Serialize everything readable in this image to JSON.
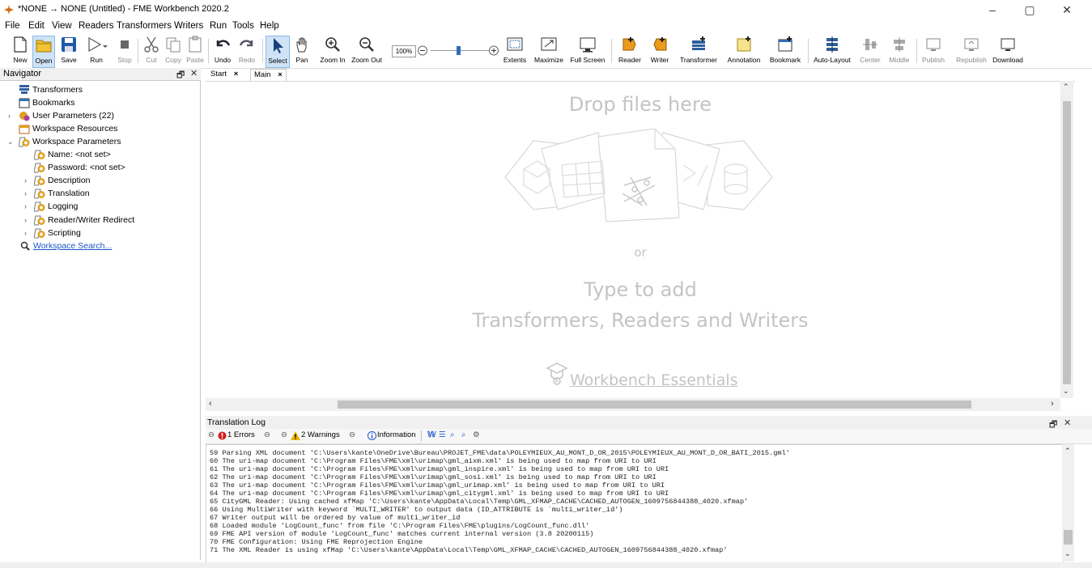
{
  "window": {
    "title": "*NONE → NONE (Untitled) - FME Workbench 2020.2",
    "minimize_glyph": "–",
    "maximize_glyph": "▢",
    "close_glyph": "✕"
  },
  "menu": [
    "File",
    "Edit",
    "View",
    "Readers",
    "Transformers",
    "Writers",
    "Run",
    "Tools",
    "Help"
  ],
  "toolbar": {
    "new": "New",
    "open": "Open",
    "save": "Save",
    "run": "Run",
    "stop": "Stop",
    "cut": "Cut",
    "copy": "Copy",
    "paste": "Paste",
    "undo": "Undo",
    "redo": "Redo",
    "select": "Select",
    "pan": "Pan",
    "zoom_in": "Zoom In",
    "zoom_out": "Zoom Out",
    "zoom_level": "100%",
    "extents": "Extents",
    "maximize": "Maximize",
    "full_screen": "Full Screen",
    "reader": "Reader",
    "writer": "Writer",
    "transformer": "Transformer",
    "annotation": "Annotation",
    "bookmark": "Bookmark",
    "auto_layout": "Auto-Layout",
    "center": "Center",
    "middle": "Middle",
    "publish": "Publish",
    "republish": "Republish",
    "download": "Download"
  },
  "navigator": {
    "title": "Navigator",
    "items": [
      {
        "label": "Transformers"
      },
      {
        "label": "Bookmarks"
      },
      {
        "label": "User Parameters (22)"
      },
      {
        "label": "Workspace Resources"
      },
      {
        "label": "Workspace Parameters"
      },
      {
        "label": "Name: <not set>"
      },
      {
        "label": "Password: <not set>"
      },
      {
        "label": "Description"
      },
      {
        "label": "Translation"
      },
      {
        "label": "Logging"
      },
      {
        "label": "Reader/Writer Redirect"
      },
      {
        "label": "Scripting"
      },
      {
        "label": "Workspace Search..."
      }
    ]
  },
  "tabs": [
    {
      "label": "Start"
    },
    {
      "label": "Main"
    }
  ],
  "canvas": {
    "drop_files": "Drop files here",
    "or": "or",
    "type_to_add": "Type to add",
    "type_to_add_2": "Transformers, Readers and Writers",
    "essentials_link": "Workbench Essentials"
  },
  "log": {
    "title": "Translation Log",
    "errors": "1 Errors",
    "warnings": "2 Warnings",
    "information": "Information",
    "lines": [
      "59 Parsing XML document 'C:\\Users\\kante\\OneDrive\\Bureau\\PROJET_FME\\data\\POLEYMIEUX_AU_MONT_D_OR_2015\\POLEYMIEUX_AU_MONT_D_OR_BATI_2015.gml'",
      "60 The uri-map document 'C:\\Program Files\\FME\\xml\\urimap\\gml_aixm.xml' is being used to map from URI to URI",
      "61 The uri-map document 'C:\\Program Files\\FME\\xml\\urimap\\gml_inspire.xml' is being used to map from URI to URI",
      "62 The uri-map document 'C:\\Program Files\\FME\\xml\\urimap\\gml_sosi.xml' is being used to map from URI to URI",
      "63 The uri-map document 'C:\\Program Files\\FME\\xml\\urimap\\gml_urimap.xml' is being used to map from URI to URI",
      "64 The uri-map document 'C:\\Program Files\\FME\\xml\\urimap\\gml_citygml.xml' is being used to map from URI to URI",
      "65 CityGML Reader: Using cached xfMap 'C:\\Users\\kante\\AppData\\Local\\Temp\\GML_XFMAP_CACHE\\CACHED_AUTOGEN_1609756844388_4020.xfmap'",
      "66 Using MultiWriter with keyword `MULTI_WRITER' to output data (ID_ATTRIBUTE is `multi_writer_id')",
      "67 Writer output will be ordered by value of multi_writer_id",
      "68 Loaded module 'LogCount_func' from file 'C:\\Program Files\\FME\\plugins/LogCount_func.dll'",
      "69 FME API version of module 'LogCount_func' matches current internal version (3.8 20200115)",
      "70 FME Configuration: Using FME Reprojection Engine",
      "71 The XML Reader is using xfMap 'C:\\Users\\kante\\AppData\\Local\\Temp\\GML_XFMAP_CACHE\\CACHED_AUTOGEN_1609756844388_4020.xfmap'"
    ]
  },
  "colors": {
    "accent": "#1a56c9",
    "selected_bg": "#cfe3f7",
    "error": "#d11b1b",
    "warning": "#e8b400",
    "param_icon": "#e0a020",
    "canvas_hint": "#c4c4c4"
  }
}
